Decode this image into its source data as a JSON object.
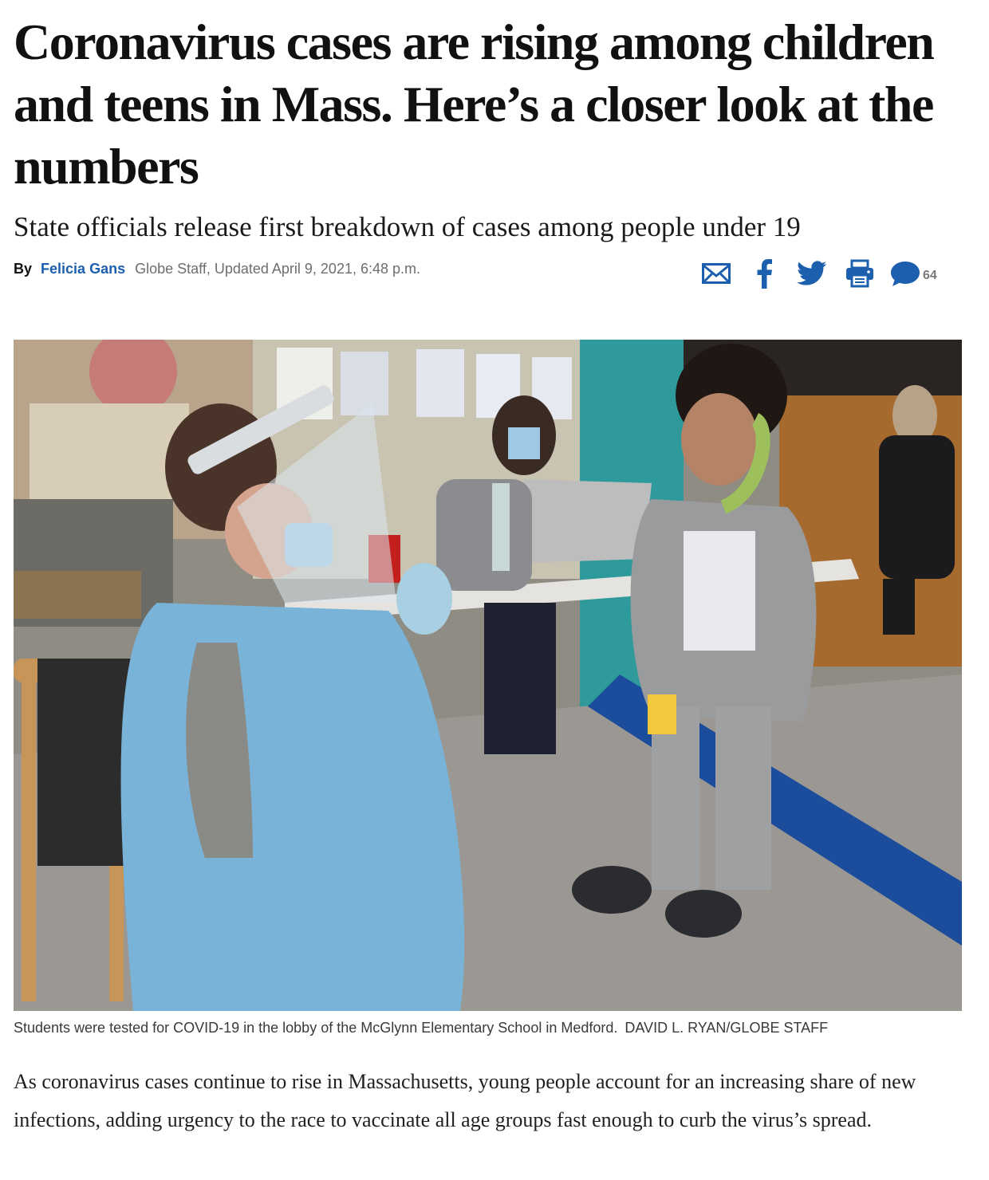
{
  "article": {
    "headline": "Coronavirus cases are rising among children and teens in Mass. Here’s a closer look at the numbers",
    "subheadline": "State officials release first breakdown of cases among people under 19",
    "byline": {
      "by": "By",
      "author": "Felicia Gans",
      "meta": "Globe Staff, Updated April 9, 2021, 6:48 p.m."
    },
    "share": {
      "icons": [
        "email-icon",
        "facebook-icon",
        "twitter-icon",
        "print-icon",
        "comment-icon"
      ],
      "comment_count": "64"
    },
    "photo": {
      "caption": "Students were tested for COVID-19 in the lobby of the McGlynn Elementary School in Medford.",
      "credit": "DAVID L. RYAN/GLOBE STAFF"
    },
    "body": [
      "As coronavirus cases continue to rise in Massachusetts, young people account for an increasing share of new infections, adding urgency to the race to vaccinate all age groups fast enough to curb the virus’s spread."
    ]
  },
  "colors": {
    "author_link": "#1c5fae",
    "share_icons": "#1c5fae",
    "text": "#111111"
  }
}
